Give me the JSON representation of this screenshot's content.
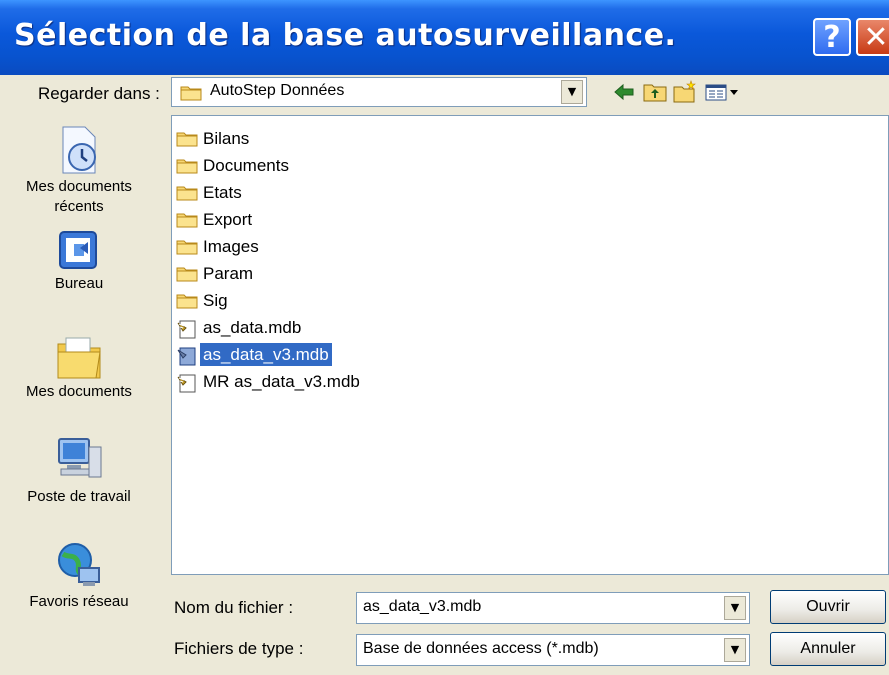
{
  "window": {
    "title": "Sélection de la base autosurveillance."
  },
  "titlebar": {
    "help_label": "?",
    "close_label": "✕"
  },
  "lookin": {
    "label": "Regarder dans :",
    "value": "AutoStep Données"
  },
  "places": [
    {
      "label": "Mes documents récents",
      "icon": "recent-documents-icon"
    },
    {
      "label": "Bureau",
      "icon": "desktop-icon"
    },
    {
      "label": "Mes documents",
      "icon": "my-documents-icon"
    },
    {
      "label": "Poste de travail",
      "icon": "my-computer-icon"
    },
    {
      "label": "Favoris réseau",
      "icon": "network-places-icon"
    }
  ],
  "files": [
    {
      "name": "Bilans",
      "type": "folder"
    },
    {
      "name": "Documents",
      "type": "folder"
    },
    {
      "name": "Etats",
      "type": "folder"
    },
    {
      "name": "Export",
      "type": "folder"
    },
    {
      "name": "Images",
      "type": "folder"
    },
    {
      "name": "Param",
      "type": "folder"
    },
    {
      "name": "Sig",
      "type": "folder"
    },
    {
      "name": "as_data.mdb",
      "type": "mdb"
    },
    {
      "name": "as_data_v3.mdb",
      "type": "mdb",
      "selected": true
    },
    {
      "name": "MR as_data_v3.mdb",
      "type": "mdb"
    }
  ],
  "filename": {
    "label": "Nom du fichier :",
    "value": "as_data_v3.mdb"
  },
  "filetype": {
    "label": "Fichiers de type :",
    "value": "Base de données access (*.mdb)"
  },
  "buttons": {
    "open": "Ouvrir",
    "cancel": "Annuler"
  },
  "colors": {
    "titlebar": "#0A58DA",
    "selection": "#316AC5",
    "face": "#ECE9D8",
    "field_border": "#7F9DB9"
  }
}
